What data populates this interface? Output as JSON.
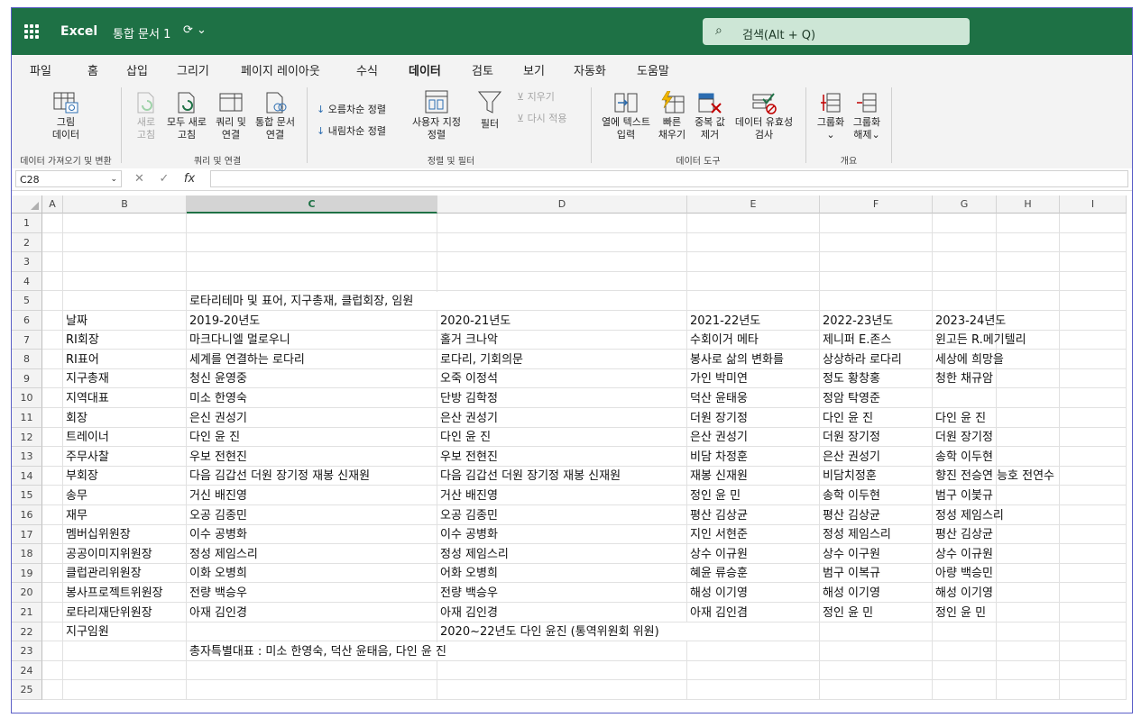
{
  "titlebar": {
    "app": "Excel",
    "document": "통합 문서 1",
    "search_placeholder": "검색(Alt + Q)"
  },
  "menu_tabs": [
    "파일",
    "홈",
    "삽입",
    "그리기",
    "페이지 레이아웃",
    "수식",
    "데이터",
    "검토",
    "보기",
    "자동화",
    "도움말"
  ],
  "active_tab": "데이터",
  "ribbon": {
    "picture_data": [
      "그림",
      "데이터"
    ],
    "refresh": [
      "새로",
      "고침"
    ],
    "refresh_all": [
      "모두 새로",
      "고침"
    ],
    "query_conn": [
      "쿼리 및",
      "연결"
    ],
    "workbook_links": [
      "통합 문서",
      "연결"
    ],
    "sort_asc": "오름차순 정렬",
    "sort_desc": "내림차순 정렬",
    "custom_sort": [
      "사용자 지정",
      "정렬"
    ],
    "filter": "필터",
    "clear": "지우기",
    "reapply": "다시 적용",
    "text_to_columns": [
      "열에 텍스트",
      "입력"
    ],
    "flash_fill": [
      "빠른",
      "채우기"
    ],
    "remove_dupes": [
      "중복 값",
      "제거"
    ],
    "data_validation": [
      "데이터 유효성",
      "검사"
    ],
    "group": [
      "그룹화",
      "⌄"
    ],
    "ungroup": [
      "그룹화",
      "해제⌄"
    ],
    "groups": {
      "get_transform": "데이터 가져오기 및 변환",
      "queries": "쿼리 및 연결",
      "sort_filter": "정렬 및 필터",
      "data_tools": "데이터 도구",
      "outline": "개요"
    }
  },
  "formula_bar": {
    "name_box": "C28",
    "fx": "fx",
    "cancel": "✕",
    "enter": "✓"
  },
  "columns": [
    "A",
    "B",
    "C",
    "D",
    "E",
    "F",
    "G",
    "H",
    "I"
  ],
  "selected_column": "C",
  "rows": [
    "1",
    "2",
    "3",
    "4",
    "5",
    "6",
    "7",
    "8",
    "9",
    "10",
    "11",
    "12",
    "13",
    "14",
    "15",
    "16",
    "17",
    "18",
    "19",
    "20",
    "21",
    "22",
    "23",
    "24",
    "25"
  ],
  "sheet": {
    "r5_c": "로타리테마 및 표어, 지구총재, 클럽회장, 임원",
    "table": [
      [
        "날짜",
        "2019-20년도",
        "2020-21년도",
        "2021-22년도",
        "2022-23년도",
        "2023-24년도"
      ],
      [
        "RI회장",
        "마크다니엘 멀로우니",
        "홀거 크나악",
        "수회이거 메타",
        "제니퍼 E.존스",
        "윈고든 R.메기텔리"
      ],
      [
        "RI표어",
        "세계를 연결하는 로다리",
        "로다리, 기회의문",
        "봉사로 삶의 변화를",
        "상상하라 로다리",
        "세상에 희망을"
      ],
      [
        "지구총재",
        "청신 윤영중",
        "오죽 이정석",
        "가인 박미연",
        "정도 황창홍",
        "청한 채규암"
      ],
      [
        "지역대표",
        "미소 한영숙",
        "단방 김학정",
        "덕산 윤태웅",
        "정암 탁영준",
        ""
      ],
      [
        "회장",
        "은신 권성기",
        "은산 권성기",
        "더원 장기정",
        "다인 윤 진",
        "다인 윤 진"
      ],
      [
        "트레이너",
        "다인 윤 진",
        "다인 윤 진",
        "은산 권성기",
        "더원 장기정",
        "더원 장기정"
      ],
      [
        "주무사찰",
        "우보 전현진",
        "우보 전현진",
        "비담 차정훈",
        "은산 권성기",
        "송학 이두현"
      ],
      [
        "부회장",
        "다음 김갑선 더원 장기정 재봉 신재원",
        "다음 김갑선 더원 장기정 재봉 신재원",
        "재봉 신재원",
        "비담치정훈",
        "향진 전승연 능호 전연수"
      ],
      [
        "송무",
        "거신 배진영",
        "거산 배진영",
        "정인 윤 민",
        "송학 이두현",
        "범구 이붗규"
      ],
      [
        "재무",
        "오공 김종민",
        "오공 김종민",
        "평산 김상균",
        "평산 김상균",
        "정성 제임스리"
      ],
      [
        "멤버십위원장",
        "이수 공병화",
        "이수 공병화",
        "지인 서현준",
        "정성 제임스리",
        "평산 김상균"
      ],
      [
        "공공이미지위원장",
        "정성 제임스리",
        "정성 제임스리",
        "상수 이규원",
        "상수 이구원",
        "상수 이규원"
      ],
      [
        "클럽관리위원장",
        "이화 오병희",
        "어화 오병희",
        "혜윤 류승훈",
        "범구 이복규",
        "아량 백승민"
      ],
      [
        "봉사프로젝트위원장",
        "전량 백승우",
        "전량 백승우",
        "해성 이기영",
        "해성 이기영",
        "해성 이기영"
      ],
      [
        "로타리재단위원장",
        "아재 김인경",
        "아재 김인경",
        "아재 김인겸",
        "정인 윤 민",
        "정인 윤 민"
      ]
    ],
    "r22_b": "지구임원",
    "r22_d": "2020~22년도 다인 윤진 (통역위원회 위원)",
    "r23_c": "총자특별대표 : 미소 한영숙, 덕산 윤태음, 다인 윤 진"
  }
}
